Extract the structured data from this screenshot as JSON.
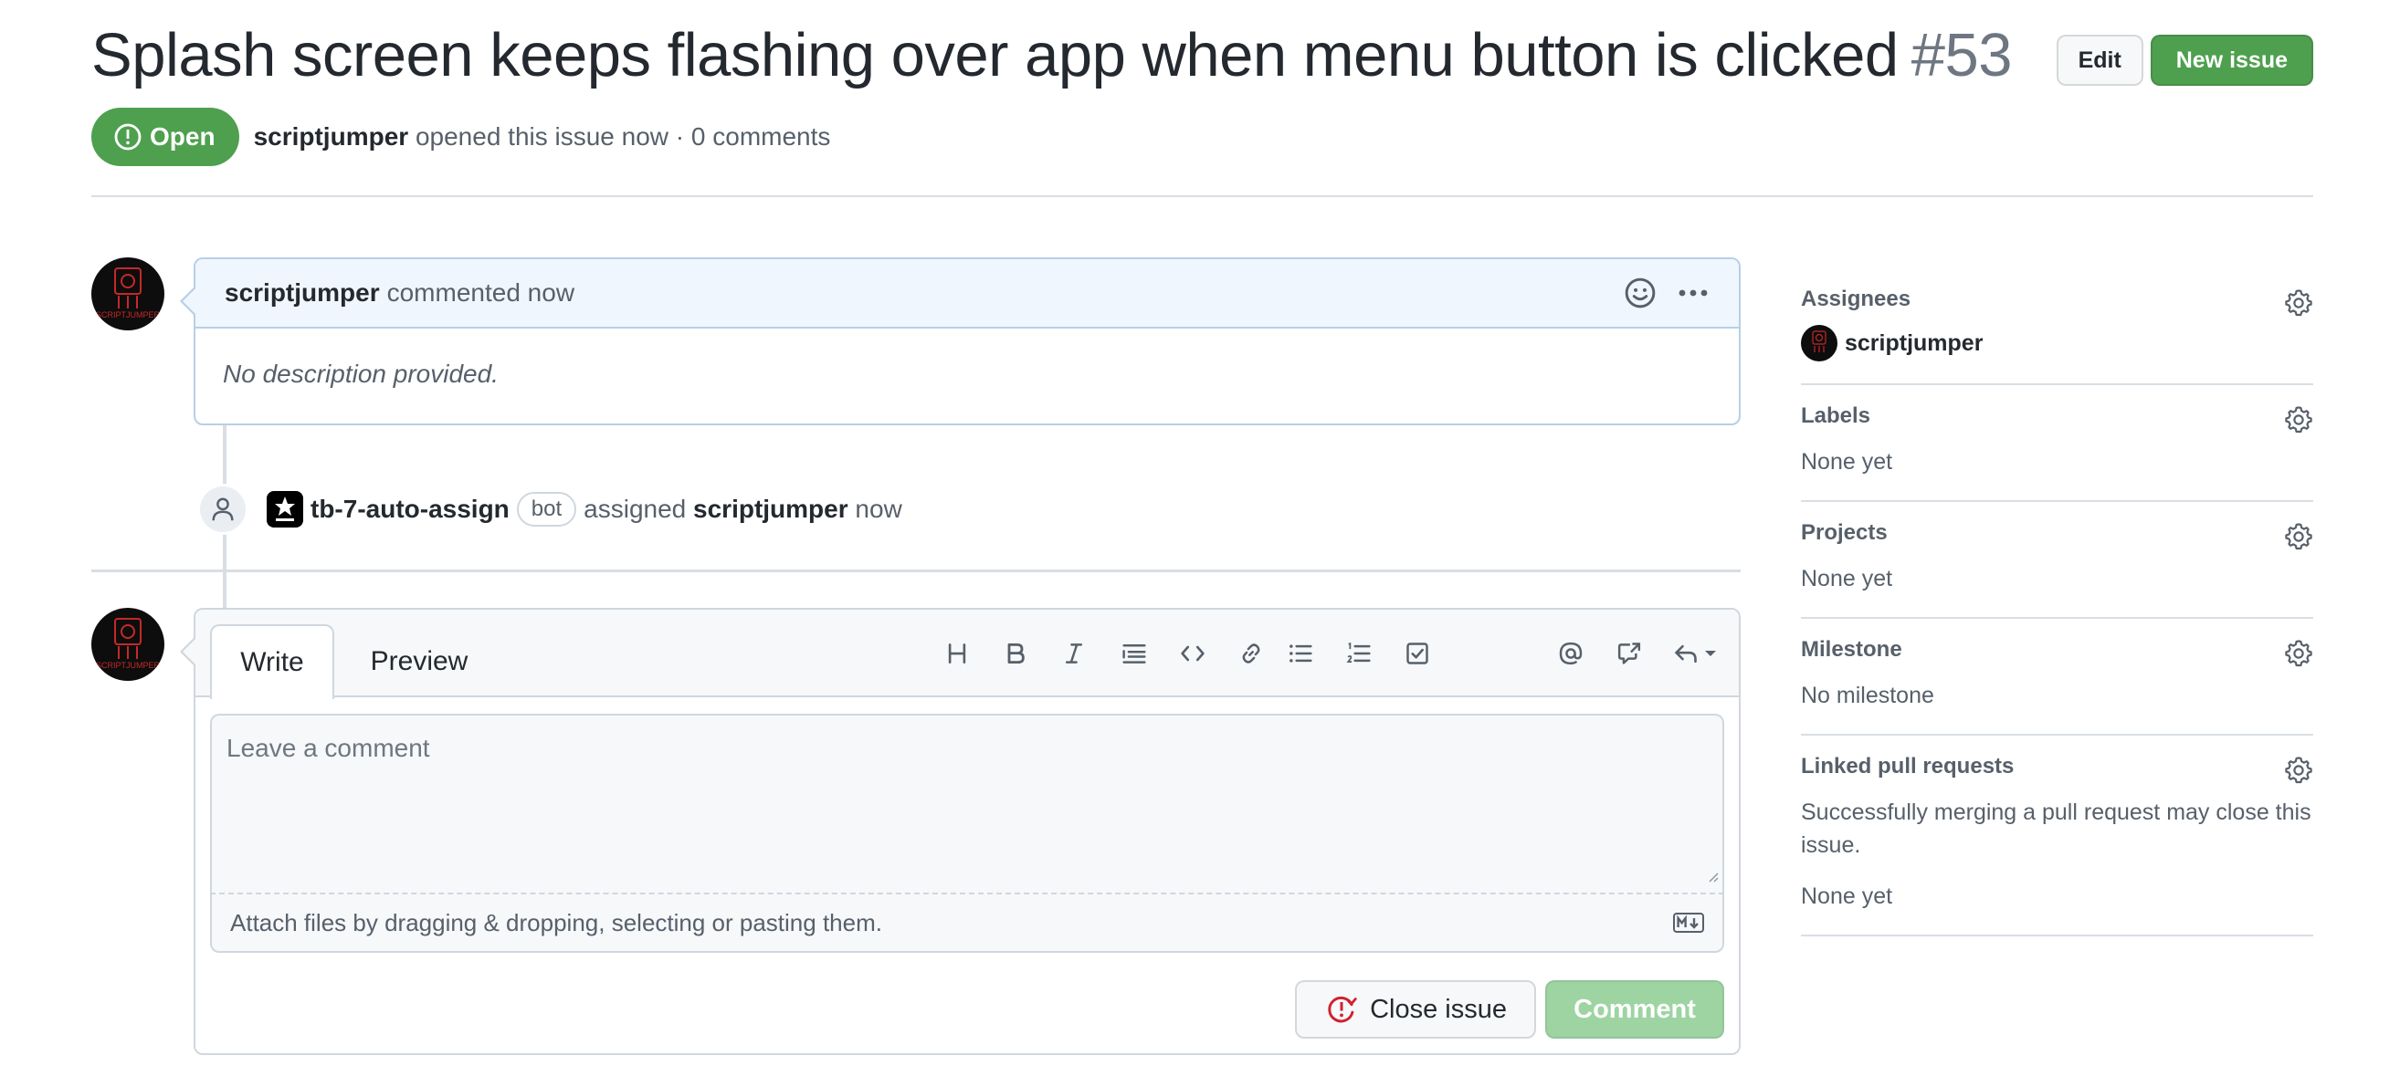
{
  "colors": {
    "open_green": "#4ea04f",
    "comment_disabled_green": "#9dd4a2",
    "comment_header_bg": "#f0f6fd",
    "close_issue_red": "#cf222e",
    "avatar_red": "#c62828"
  },
  "issue": {
    "title": "Splash screen keeps flashing over app when menu button is clicked",
    "number": "#53",
    "state": "Open",
    "author": "scriptjumper",
    "meta": "opened this issue now · 0 comments"
  },
  "header": {
    "edit_label": "Edit",
    "new_issue_label": "New issue"
  },
  "comment": {
    "author": "scriptjumper",
    "meta": "commented now",
    "body": "No description provided.",
    "avatar_text": "SCRIPTJUMPER"
  },
  "event": {
    "actor": "tb-7-auto-assign",
    "bot_badge": "bot",
    "action": "assigned",
    "target": "scriptjumper",
    "time": "now"
  },
  "composer": {
    "tabs": [
      "Write",
      "Preview"
    ],
    "placeholder": "Leave a comment",
    "attach_text": "Attach files by dragging & dropping, selecting or pasting them.",
    "close_issue_label": "Close issue",
    "comment_label": "Comment",
    "toolbar_icons": [
      "heading-icon",
      "bold-icon",
      "italic-icon",
      "quote-icon",
      "code-icon",
      "link-icon",
      "unordered-list-icon",
      "ordered-list-icon",
      "task-list-icon",
      "mention-icon",
      "cross-reference-icon",
      "saved-replies-icon"
    ]
  },
  "sidebar": {
    "assignees": {
      "title": "Assignees",
      "user": "scriptjumper"
    },
    "labels": {
      "title": "Labels",
      "value": "None yet"
    },
    "projects": {
      "title": "Projects",
      "value": "None yet"
    },
    "milestone": {
      "title": "Milestone",
      "value": "No milestone"
    },
    "linked_prs": {
      "title": "Linked pull requests",
      "description": "Successfully merging a pull request may close this issue.",
      "value": "None yet"
    }
  }
}
